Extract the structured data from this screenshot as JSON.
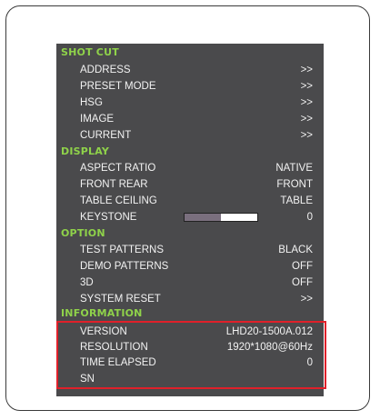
{
  "menu": {
    "sections": [
      {
        "title": "SHOT CUT",
        "items": [
          {
            "label": "ADDRESS",
            "value": ">>"
          },
          {
            "label": "PRESET MODE",
            "value": ">>"
          },
          {
            "label": "HSG",
            "value": ">>"
          },
          {
            "label": "IMAGE",
            "value": ">>"
          },
          {
            "label": "CURRENT",
            "value": ">>"
          }
        ]
      },
      {
        "title": "DISPLAY",
        "items": [
          {
            "label": "ASPECT RATIO",
            "value": "NATIVE"
          },
          {
            "label": "FRONT REAR",
            "value": "FRONT"
          },
          {
            "label": "TABLE CEILING",
            "value": "TABLE"
          },
          {
            "label": "KEYSTONE",
            "value": "0",
            "slider_level": 0.5
          }
        ]
      },
      {
        "title": "OPTION",
        "items": [
          {
            "label": "TEST PATTERNS",
            "value": "BLACK"
          },
          {
            "label": "DEMO PATTERNS",
            "value": "OFF"
          },
          {
            "label": "3D",
            "value": "OFF"
          },
          {
            "label": "SYSTEM RESET",
            "value": ">>"
          }
        ]
      },
      {
        "title": "INFORMATION",
        "items": [
          {
            "label": "VERSION",
            "value": "LHD20-1500A.012"
          },
          {
            "label": "RESOLUTION",
            "value": "1920*1080@60Hz"
          },
          {
            "label": "TIME ELAPSED",
            "value": "0"
          },
          {
            "label": "SN",
            "value": ""
          }
        ]
      }
    ]
  },
  "colors": {
    "panel_bg": "#4a4a4c",
    "section_title": "#8fd24a",
    "item_text": "#f2f2f2",
    "highlight_border": "#e0202a",
    "slider_fill": "#7a6f7e"
  }
}
